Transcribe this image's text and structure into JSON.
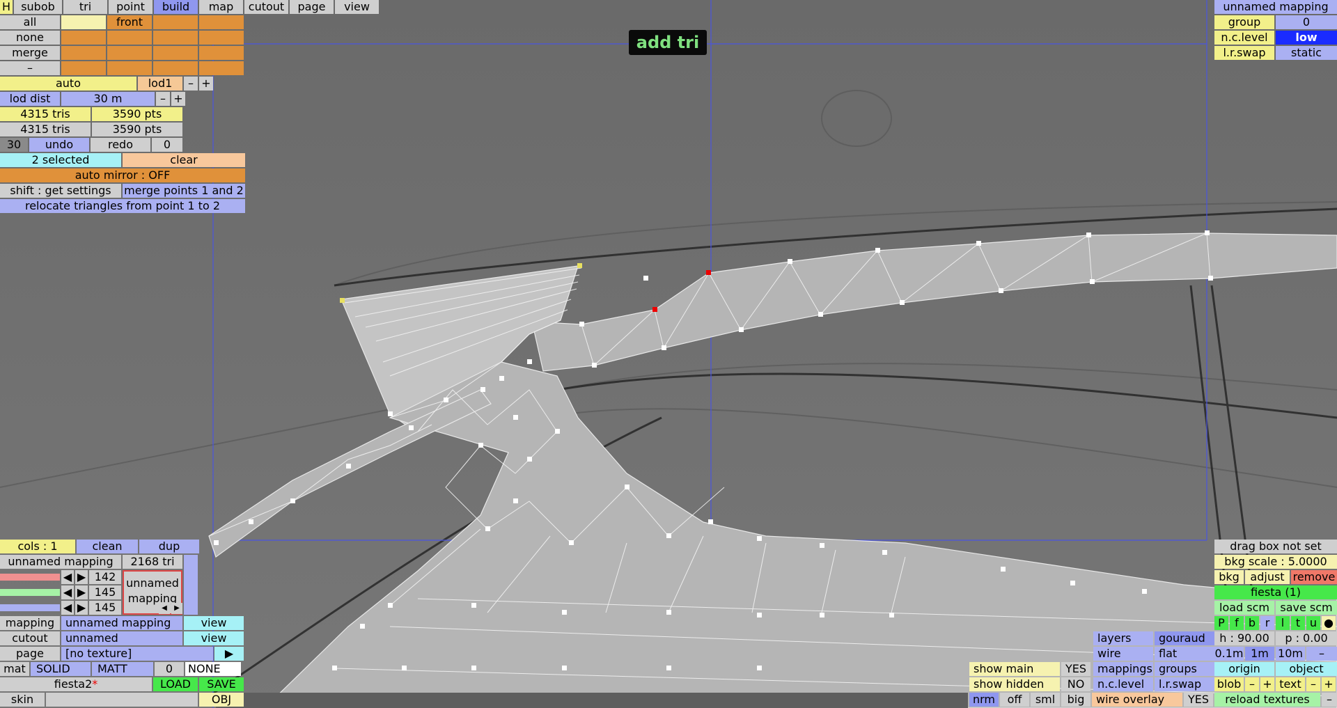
{
  "mode_label": "add tri",
  "menu": [
    "H",
    "subob",
    "tri",
    "point",
    "build",
    "map",
    "cutout",
    "page",
    "view"
  ],
  "select": {
    "all": "all",
    "none": "none",
    "merge": "merge",
    "dash": "–",
    "front": "front"
  },
  "lod": {
    "auto": "auto",
    "lod1": "lod1",
    "minus": "–",
    "plus": "+",
    "dist_label": "lod dist",
    "dist_value": "30 m"
  },
  "stats": {
    "tris1": "4315 tris",
    "pts1": "3590 pts",
    "tris2": "4315 tris",
    "pts2": "3590 pts"
  },
  "undo": {
    "count": "30",
    "undo": "undo",
    "redo": "redo",
    "redo_count": "0"
  },
  "selection": {
    "selected": "2 selected",
    "clear": "clear",
    "mirror": "auto mirror : OFF",
    "shift": "shift : get settings",
    "merge_pts": "merge points 1 and 2",
    "relocate": "relocate triangles from point 1 to 2"
  },
  "top_right": {
    "mapping": "unnamed mapping",
    "group_label": "group",
    "group_value": "0",
    "nclevel_label": "n.c.level",
    "nclevel_value": "low",
    "lrswap_label": "l.r.swap",
    "lrswap_value": "static"
  },
  "bottom_left": {
    "cols": "cols : 1",
    "clean": "clean",
    "dup": "dup",
    "mapping_name": "unnamed mapping",
    "tri_count": "2168 tri",
    "r": "142",
    "g": "145",
    "b": "145",
    "preview": "unnamed mapping",
    "mapping_label": "mapping",
    "mapping_value": "unnamed mapping",
    "view1": "view",
    "cutout_label": "cutout",
    "cutout_value": "unnamed",
    "view2": "view",
    "page_label": "page",
    "page_value": "[no texture]",
    "page_arrow": "▶",
    "mat": "mat",
    "solid": "SOLID",
    "matt": "MATT",
    "mat_num": "0",
    "none": "NONE",
    "file": "fiesta2",
    "file_mark": "*",
    "load": "LOAD",
    "save": "SAVE",
    "skin": "skin",
    "obj": "OBJ"
  },
  "bottom_right": {
    "dragbox": "drag box not set",
    "bkgscale": "bkg scale : 5.0000",
    "bkg": "bkg",
    "adjust": "adjust",
    "remove": "remove",
    "fiesta": "fiesta (1)",
    "load_scm": "load scm",
    "save_scm": "save scm",
    "views": [
      "P",
      "f",
      "b",
      "r",
      "l",
      "t",
      "u",
      "●"
    ],
    "h": "h : 90.00",
    "p": "p : 0.00",
    "s01": "0.1m",
    "s1": "1m",
    "s10": "10m",
    "sminus": "–",
    "origin": "origin",
    "object": "object",
    "blob": "blob",
    "bminus": "–",
    "bplus": "+",
    "text": "text",
    "tminus": "–",
    "tplus": "+",
    "reload": "reload textures",
    "rminus": "–",
    "layers": "layers",
    "gouraud": "gouraud",
    "wire": "wire",
    "flat": "flat",
    "mappings": "mappings",
    "groups": "groups",
    "nclevel": "n.c.level",
    "lrswap": "l.r.swap",
    "show_main": "show main",
    "show_main_v": "YES",
    "show_hidden": "show hidden",
    "show_hidden_v": "NO",
    "nrm": "nrm",
    "off": "off",
    "sml": "sml",
    "big": "big",
    "wire_overlay": "wire overlay",
    "wire_overlay_v": "YES"
  }
}
